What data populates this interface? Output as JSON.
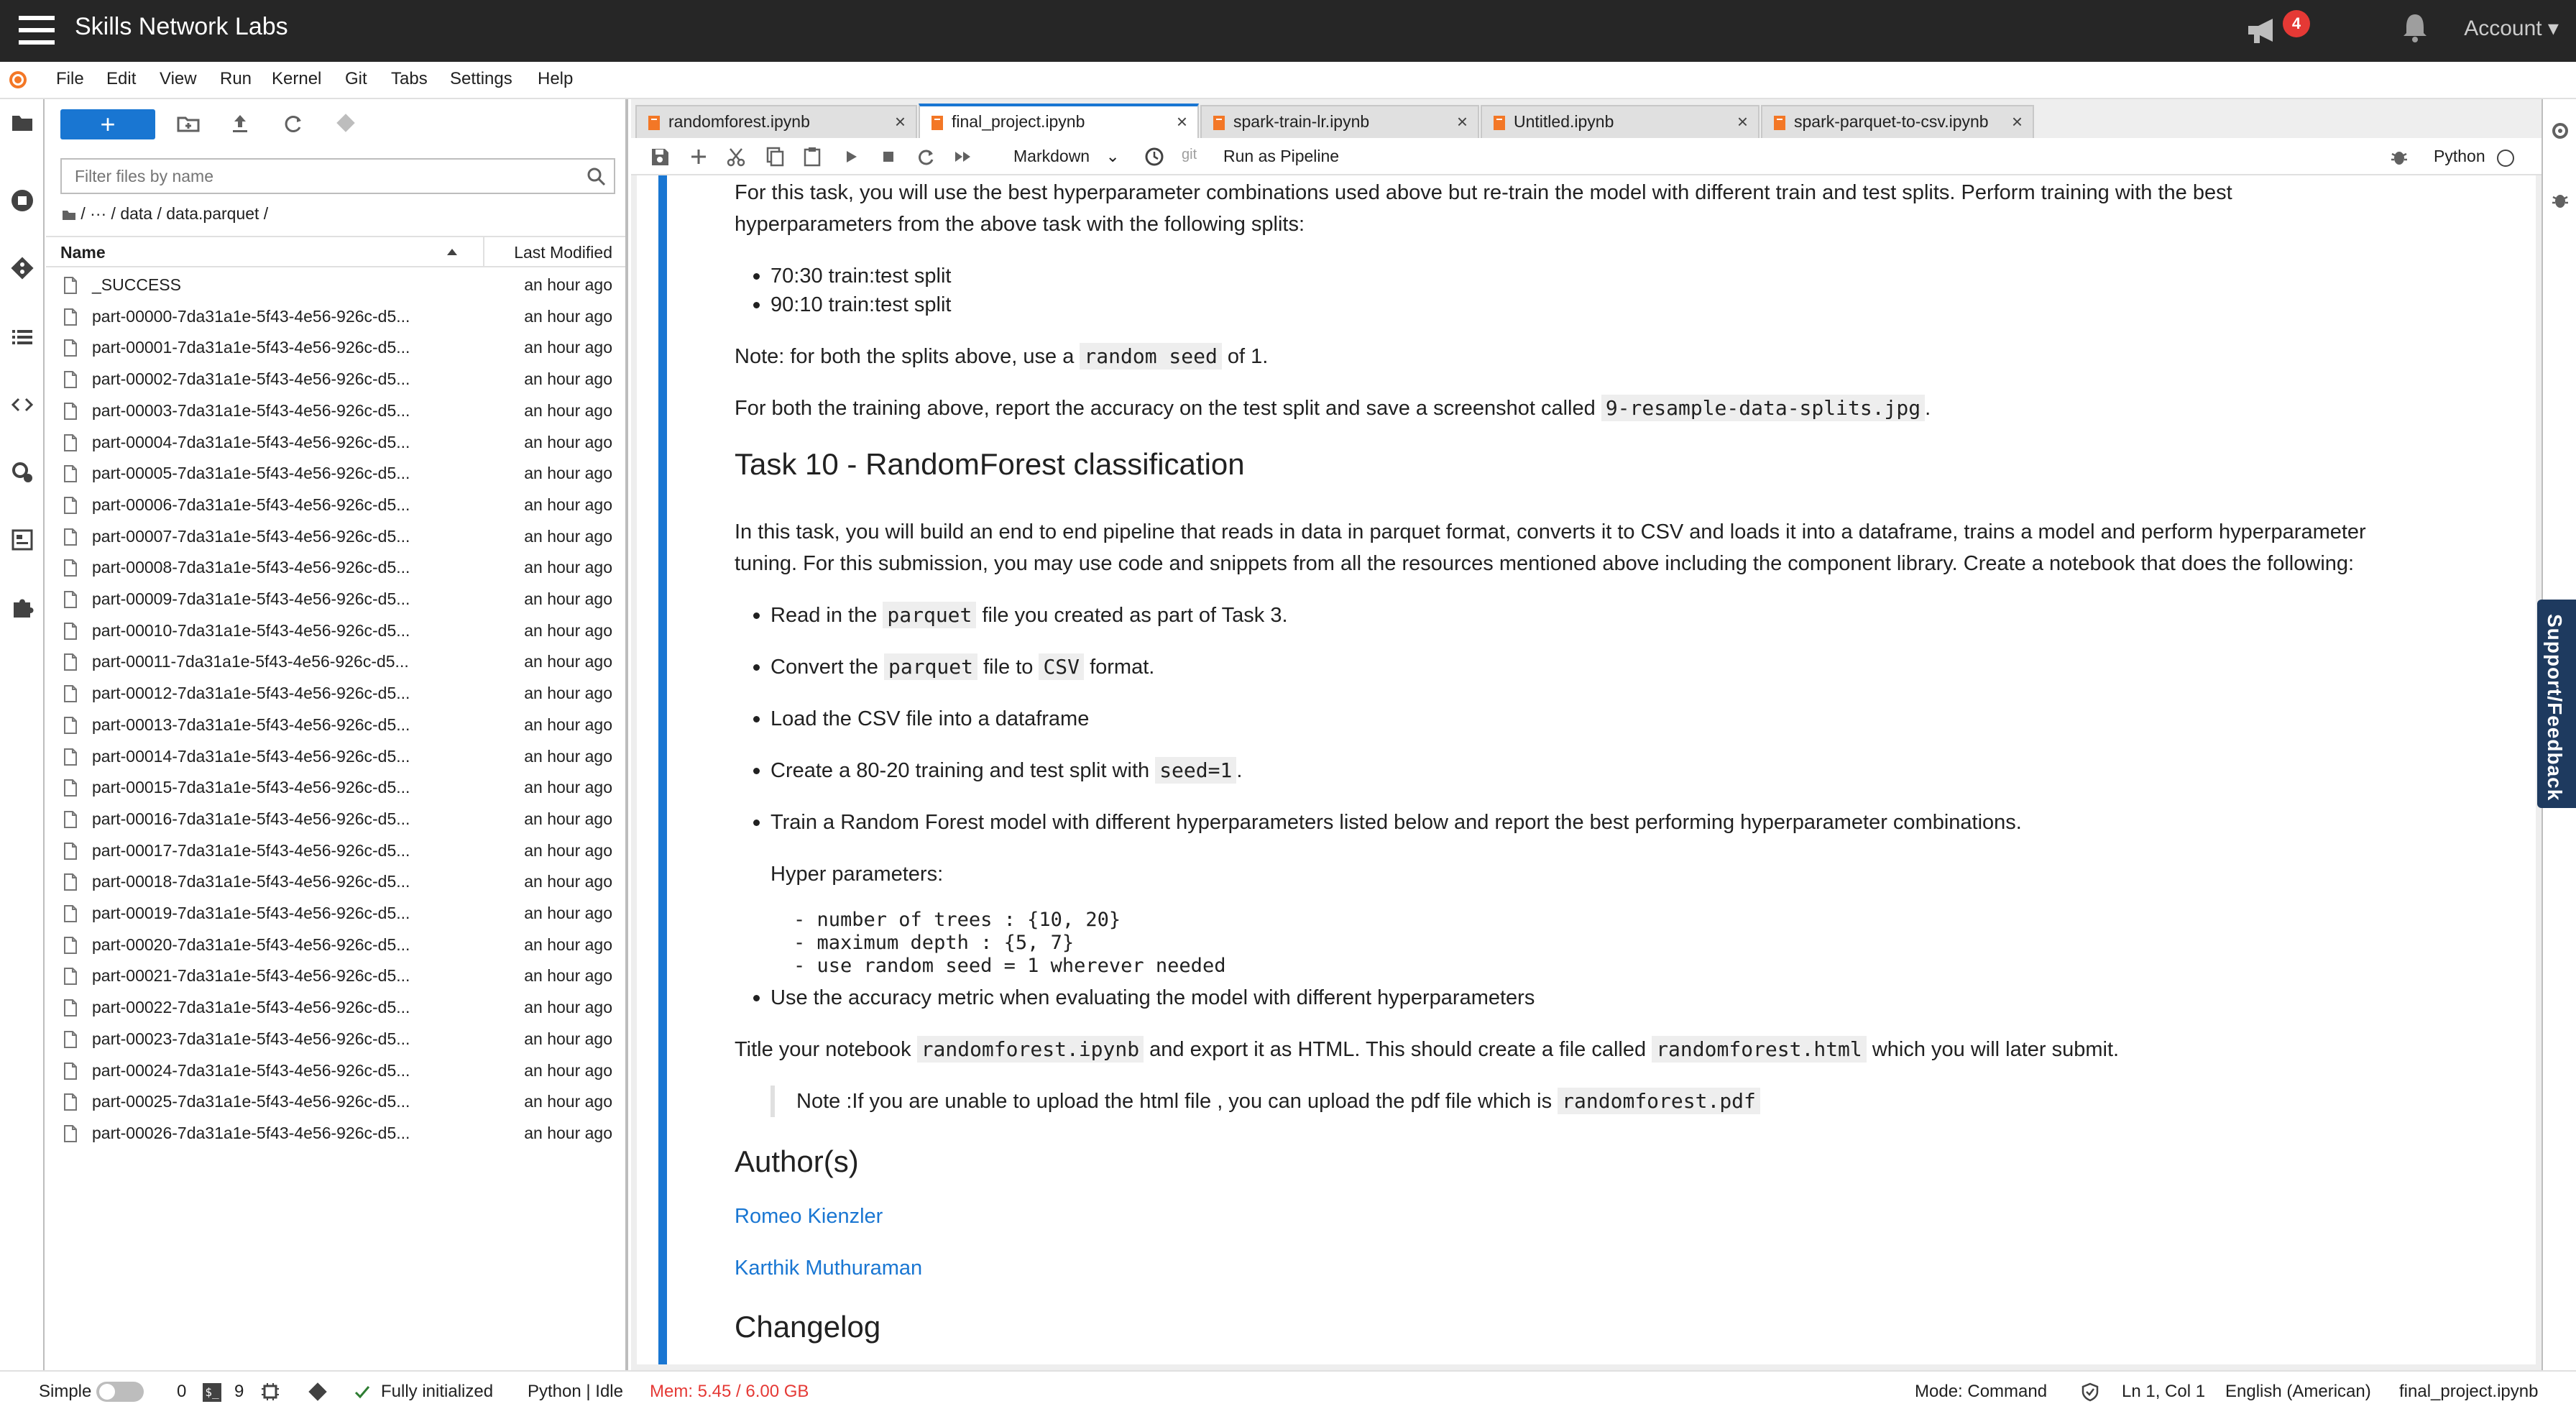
{
  "topbar": {
    "title": "Skills Network Labs",
    "notifications_count": "4",
    "account_label": "Account"
  },
  "menu": [
    "File",
    "Edit",
    "View",
    "Run",
    "Kernel",
    "Git",
    "Tabs",
    "Settings",
    "Help"
  ],
  "filebrowser": {
    "filter_placeholder": "Filter files by name",
    "breadcrumb": "/  ···  / data / data.parquet /",
    "col_name": "Name",
    "col_modified": "Last Modified",
    "files": [
      {
        "name": "_SUCCESS",
        "modified": "an hour ago"
      },
      {
        "name": "part-00000-7da31a1e-5f43-4e56-926c-d5...",
        "modified": "an hour ago"
      },
      {
        "name": "part-00001-7da31a1e-5f43-4e56-926c-d5...",
        "modified": "an hour ago"
      },
      {
        "name": "part-00002-7da31a1e-5f43-4e56-926c-d5...",
        "modified": "an hour ago"
      },
      {
        "name": "part-00003-7da31a1e-5f43-4e56-926c-d5...",
        "modified": "an hour ago"
      },
      {
        "name": "part-00004-7da31a1e-5f43-4e56-926c-d5...",
        "modified": "an hour ago"
      },
      {
        "name": "part-00005-7da31a1e-5f43-4e56-926c-d5...",
        "modified": "an hour ago"
      },
      {
        "name": "part-00006-7da31a1e-5f43-4e56-926c-d5...",
        "modified": "an hour ago"
      },
      {
        "name": "part-00007-7da31a1e-5f43-4e56-926c-d5...",
        "modified": "an hour ago"
      },
      {
        "name": "part-00008-7da31a1e-5f43-4e56-926c-d5...",
        "modified": "an hour ago"
      },
      {
        "name": "part-00009-7da31a1e-5f43-4e56-926c-d5...",
        "modified": "an hour ago"
      },
      {
        "name": "part-00010-7da31a1e-5f43-4e56-926c-d5...",
        "modified": "an hour ago"
      },
      {
        "name": "part-00011-7da31a1e-5f43-4e56-926c-d5...",
        "modified": "an hour ago"
      },
      {
        "name": "part-00012-7da31a1e-5f43-4e56-926c-d5...",
        "modified": "an hour ago"
      },
      {
        "name": "part-00013-7da31a1e-5f43-4e56-926c-d5...",
        "modified": "an hour ago"
      },
      {
        "name": "part-00014-7da31a1e-5f43-4e56-926c-d5...",
        "modified": "an hour ago"
      },
      {
        "name": "part-00015-7da31a1e-5f43-4e56-926c-d5...",
        "modified": "an hour ago"
      },
      {
        "name": "part-00016-7da31a1e-5f43-4e56-926c-d5...",
        "modified": "an hour ago"
      },
      {
        "name": "part-00017-7da31a1e-5f43-4e56-926c-d5...",
        "modified": "an hour ago"
      },
      {
        "name": "part-00018-7da31a1e-5f43-4e56-926c-d5...",
        "modified": "an hour ago"
      },
      {
        "name": "part-00019-7da31a1e-5f43-4e56-926c-d5...",
        "modified": "an hour ago"
      },
      {
        "name": "part-00020-7da31a1e-5f43-4e56-926c-d5...",
        "modified": "an hour ago"
      },
      {
        "name": "part-00021-7da31a1e-5f43-4e56-926c-d5...",
        "modified": "an hour ago"
      },
      {
        "name": "part-00022-7da31a1e-5f43-4e56-926c-d5...",
        "modified": "an hour ago"
      },
      {
        "name": "part-00023-7da31a1e-5f43-4e56-926c-d5...",
        "modified": "an hour ago"
      },
      {
        "name": "part-00024-7da31a1e-5f43-4e56-926c-d5...",
        "modified": "an hour ago"
      },
      {
        "name": "part-00025-7da31a1e-5f43-4e56-926c-d5...",
        "modified": "an hour ago"
      },
      {
        "name": "part-00026-7da31a1e-5f43-4e56-926c-d5...",
        "modified": "an hour ago"
      }
    ]
  },
  "tabs": [
    {
      "label": "randomforest.ipynb",
      "active": false
    },
    {
      "label": "final_project.ipynb",
      "active": true
    },
    {
      "label": "spark-train-lr.ipynb",
      "active": false
    },
    {
      "label": "Untitled.ipynb",
      "active": false
    },
    {
      "label": "spark-parquet-to-csv.ipynb",
      "active": false
    }
  ],
  "toolbar": {
    "cell_type": "Markdown",
    "git": "git",
    "pipeline": "Run as Pipeline",
    "kernel": "Python"
  },
  "notebook": {
    "p1a": "For this task, you will use the best hyperparameter combinations used above but re-train the model with different train and test splits. Perform training with the best",
    "p1b": "hyperparameters from the above task with the following splits:",
    "split1": "70:30 train:test split",
    "split2": "90:10 train:test split",
    "note_pre": "Note: for both the splits above, use a",
    "note_code": "random seed",
    "note_post": "of 1.",
    "report_pre": "For both the training above, report the accuracy on the test split and save a screenshot called",
    "report_code": "9-resample-data-splits.jpg",
    "report_post": ".",
    "task10_title": "Task 10 - RandomForest classification",
    "t10a": "In this task, you will build an end to end pipeline that reads in data in parquet format, converts it to CSV and loads it into a dataframe, trains a model and perform hyperparameter",
    "t10b": "tuning. For this submission, you may use code and snippets from all the resources mentioned above including the component library. Create a notebook that does the following:",
    "b1_pre": "Read in the",
    "b1_code": "parquet",
    "b1_post": "file you created as part of Task 3.",
    "b2_pre": "Convert the",
    "b2_code1": "parquet",
    "b2_mid": "file to",
    "b2_code2": "CSV",
    "b2_post": "format.",
    "b3": "Load the CSV file into a dataframe",
    "b4_pre": "Create a 80-20 training and test split with",
    "b4_code": "seed=1",
    "b4_post": ".",
    "b5": "Train a Random Forest model with different hyperparameters listed below and report the best performing hyperparameter combinations.",
    "hyper_label": "Hyper parameters:",
    "hp1": "- number of trees : {10, 20}",
    "hp2": "- maximum depth : {5, 7}",
    "hp3": "- use random seed = 1 wherever needed",
    "b6": "Use the accuracy metric when evaluating the model with different hyperparameters",
    "title_pre": "Title your notebook",
    "title_code1": "randomforest.ipynb",
    "title_mid": "and export it as HTML. This should create a file called",
    "title_code2": "randomforest.html",
    "title_post": "which you will later submit.",
    "quote_pre": "Note :If you are unable to upload the html file , you can upload the pdf file which is",
    "quote_code": "randomforest.pdf",
    "authors_title": "Author(s)",
    "author1": "Romeo Kienzler",
    "author2": "Karthik Muthuraman",
    "changelog_title": "Changelog"
  },
  "support_label": "Support/Feedback",
  "status": {
    "mode_label": "Simple",
    "terminals": "0",
    "kernels": "9",
    "init": "Fully initialized",
    "kernel_status": "Python | Idle",
    "mem": "Mem: 5.45 / 6.00 GB",
    "command_mode": "Mode: Command",
    "position": "Ln 1, Col 1",
    "language": "English (American)",
    "filename": "final_project.ipynb"
  },
  "colors": {
    "accent": "#1976d2",
    "topbar": "#262626",
    "mem": "#e53935",
    "support": "#1e3a5f"
  }
}
